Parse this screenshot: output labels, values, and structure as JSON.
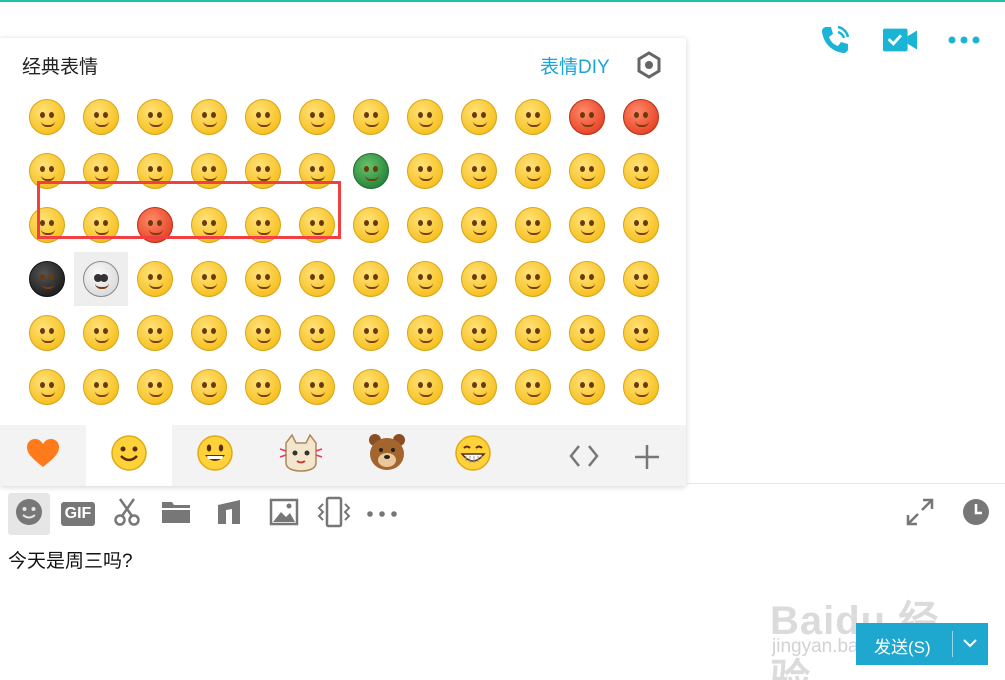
{
  "panel": {
    "title": "经典表情",
    "diy_label": "表情DIY"
  },
  "icons": {
    "header": [
      "phone-icon",
      "video-call-icon",
      "more-icon"
    ],
    "panel": [
      "gear-icon"
    ],
    "tabs": [
      "heart-icon",
      "smiley-face-icon",
      "big-smile-icon",
      "cat-sticker-icon",
      "bear-sticker-icon",
      "grin-icon",
      "nav-arrows-icon",
      "add-icon"
    ],
    "toolbar": [
      "emoji-icon",
      "gif-icon",
      "scissors-icon",
      "folder-icon",
      "music-note-icon",
      "image-icon",
      "shake-icon",
      "more-dots-icon",
      "expand-icon",
      "history-clock-icon"
    ]
  },
  "toolbar": {
    "gif_label": "GIF"
  },
  "message": {
    "text": "今天是周三吗?"
  },
  "send": {
    "label": "发送(S)"
  },
  "watermark": {
    "brand": "Baidu 经验",
    "domain": "jingyan.baidu.com"
  },
  "colors": {
    "accent": "#1fa8cf",
    "highlight_box": "#f24040",
    "top_line": "#1cc2a3",
    "header_icon": "#1ab4d6"
  }
}
